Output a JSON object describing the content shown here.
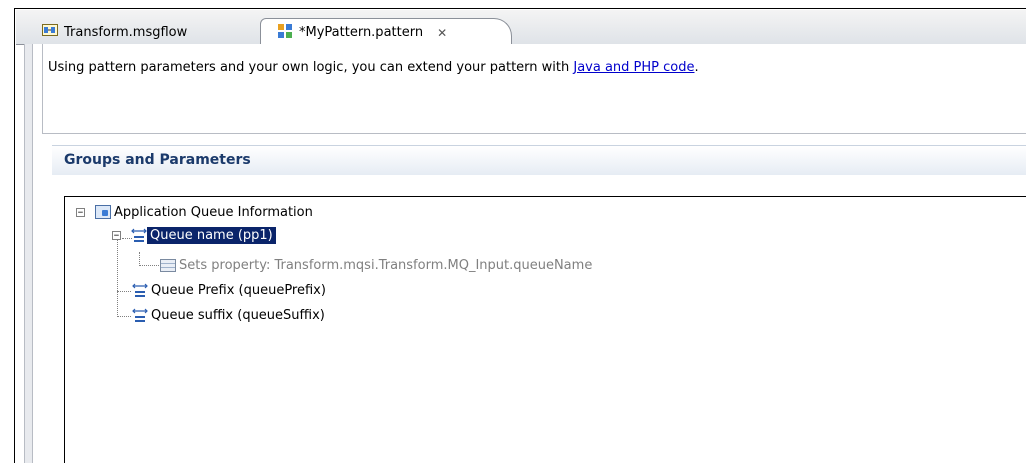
{
  "tabs": [
    {
      "label": "Transform.msgflow",
      "icon": "msgflow-icon",
      "active": false
    },
    {
      "label": "*MyPattern.pattern",
      "icon": "pattern-icon",
      "active": true,
      "close": "✕"
    }
  ],
  "description": {
    "text": "Using pattern parameters and your own logic, you can extend your pattern with ",
    "link": "Java and PHP code",
    "suffix": "."
  },
  "section": {
    "title": "Groups and Parameters"
  },
  "tree": {
    "group": {
      "label": "Application Queue Information",
      "expander": "−"
    },
    "params": [
      {
        "label": "Queue name (pp1)",
        "selected": true,
        "expander": "−",
        "children": [
          {
            "label": "Sets property: Transform.mqsi.Transform.MQ_Input.queueName"
          }
        ]
      },
      {
        "label": "Queue Prefix (queuePrefix)",
        "selected": false
      },
      {
        "label": "Queue suffix (queueSuffix)",
        "selected": false
      }
    ]
  },
  "colors": {
    "selection": "#0a246a",
    "link": "#0000cc",
    "section_title": "#1b3a6b"
  }
}
